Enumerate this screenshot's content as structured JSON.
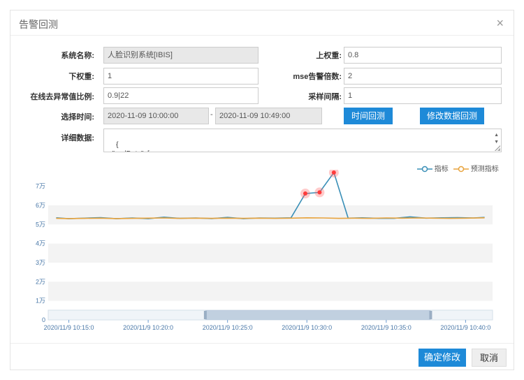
{
  "dialog": {
    "title": "告警回测",
    "close_glyph": "×"
  },
  "form": {
    "system_name": {
      "label": "系统名称:",
      "value": "人脸识别系统[IBIS]"
    },
    "upper_weight": {
      "label": "上权重:",
      "value": "0.8"
    },
    "lower_weight": {
      "label": "下权重:",
      "value": "1"
    },
    "mse_multiple": {
      "label": "mse告警倍数:",
      "value": "2"
    },
    "outlier_ratio": {
      "label": "在线去异常值比例:",
      "value": "0.9|22"
    },
    "sample_interval": {
      "label": "采样间隔:",
      "value": "1"
    },
    "select_time": {
      "label": "选择时间:",
      "start": "2020-11-09 10:00:00",
      "separator": "-",
      "end": "2020-11-09 10:49:00"
    },
    "time_backtest_button": "时间回测",
    "modify_data_backtest_button": "修改数据回测",
    "detail": {
      "label": "详细数据:",
      "value": "{\n  \"realData\": ["
    }
  },
  "chart_data": {
    "type": "line",
    "y_tick_labels": [
      "0",
      "1万",
      "2万",
      "3万",
      "4万",
      "5万",
      "6万",
      "7万"
    ],
    "ylim": [
      0,
      75000
    ],
    "x_tick_labels": [
      "2020/11/9 10:15:0",
      "2020/11/9 10:20:0",
      "2020/11/9 10:25:0",
      "2020/11/9 10:30:0",
      "2020/11/9 10:35:0",
      "2020/11/9 10:40:0"
    ],
    "x_ticks_minutes": [
      15,
      20,
      25,
      30,
      35,
      40
    ],
    "xlim_minutes": [
      13.7,
      41.7
    ],
    "grid": "alternating horizontal bands",
    "legend": {
      "position": "top-right"
    },
    "series": [
      {
        "name": "指标",
        "color": "#3a8fb7",
        "x_minutes": [
          14.2,
          15,
          16,
          17,
          18,
          19,
          20,
          21,
          22,
          23,
          24,
          25,
          26,
          27,
          28,
          29,
          29.9,
          30.8,
          31.7,
          32.6,
          33.5,
          34.5,
          35.5,
          36.5,
          37.5,
          38.5,
          39.5,
          40.5,
          41.2
        ],
        "values": [
          53500,
          53000,
          53300,
          53600,
          53000,
          53400,
          53000,
          53800,
          53200,
          53400,
          53100,
          53700,
          53000,
          53400,
          53300,
          53500,
          66200,
          66800,
          77200,
          53300,
          53500,
          53200,
          53200,
          54000,
          53300,
          53500,
          53600,
          53400,
          53700
        ],
        "highlighted_points_x_minutes": [
          29.9,
          30.8,
          31.7
        ]
      },
      {
        "name": "预测指标",
        "color": "#e8a33d",
        "x_minutes": [
          14.2,
          15,
          16,
          17,
          18,
          19,
          20,
          21,
          22,
          23,
          24,
          25,
          26,
          27,
          28,
          29,
          30,
          31,
          32,
          33,
          34,
          35,
          36,
          37,
          38,
          39,
          40,
          41.2
        ],
        "values": [
          53200,
          53100,
          53200,
          53300,
          53100,
          53200,
          53300,
          53400,
          53200,
          53300,
          53200,
          53300,
          53200,
          53300,
          53200,
          53300,
          53500,
          53400,
          53200,
          53300,
          53200,
          53400,
          53300,
          53400,
          53300,
          53200,
          53300,
          53500
        ]
      }
    ],
    "data_zoom": {
      "start_minutes": 23.6,
      "end_minutes": 37.8
    }
  },
  "footer": {
    "confirm_button": "确定修改",
    "cancel_button": "取消"
  }
}
